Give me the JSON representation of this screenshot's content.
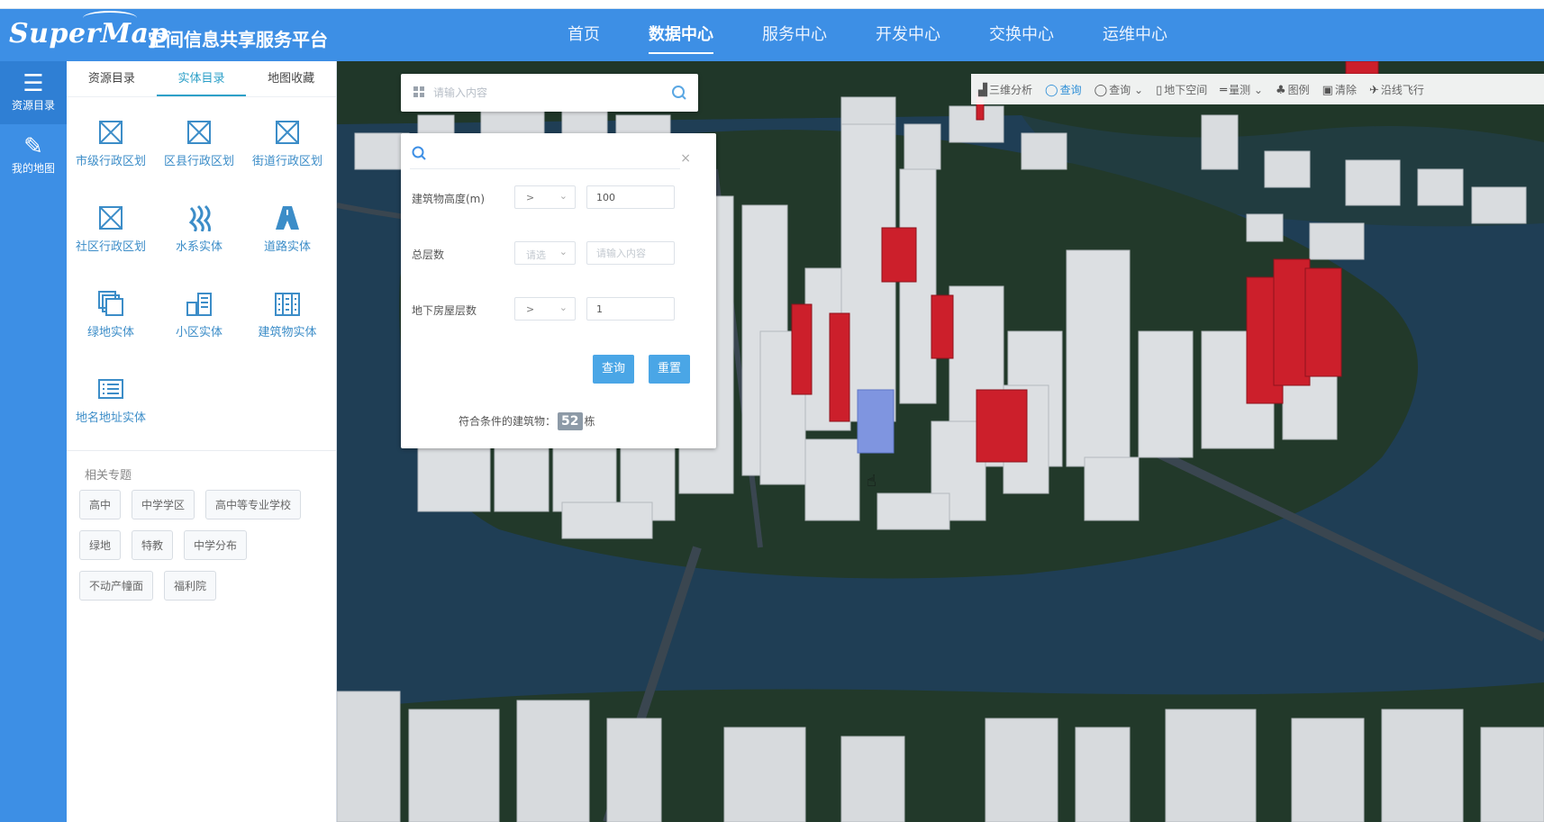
{
  "header": {
    "logo": "SuperMap",
    "platform_title": "空间信息共享服务平台",
    "nav": [
      {
        "label": "首页",
        "active": false
      },
      {
        "label": "数据中心",
        "active": true
      },
      {
        "label": "服务中心",
        "active": false
      },
      {
        "label": "开发中心",
        "active": false
      },
      {
        "label": "交换中心",
        "active": false
      },
      {
        "label": "运维中心",
        "active": false
      }
    ]
  },
  "rail": {
    "items": [
      {
        "label": "资源目录",
        "icon": "list-icon",
        "active": true
      },
      {
        "label": "我的地图",
        "icon": "edit-icon",
        "active": false
      }
    ]
  },
  "catalog": {
    "tabs": [
      {
        "label": "资源目录",
        "active": false
      },
      {
        "label": "实体目录",
        "active": true
      },
      {
        "label": "地图收藏",
        "active": false
      }
    ],
    "items": [
      {
        "label": "市级行政区划",
        "icon": "boundary-icon"
      },
      {
        "label": "区县行政区划",
        "icon": "boundary-icon"
      },
      {
        "label": "街道行政区划",
        "icon": "boundary-icon"
      },
      {
        "label": "社区行政区划",
        "icon": "boundary-icon"
      },
      {
        "label": "水系实体",
        "icon": "water-icon"
      },
      {
        "label": "道路实体",
        "icon": "road-icon"
      },
      {
        "label": "绿地实体",
        "icon": "layers-icon"
      },
      {
        "label": "小区实体",
        "icon": "residential-icon"
      },
      {
        "label": "建筑物实体",
        "icon": "building-icon"
      },
      {
        "label": "地名地址实体",
        "icon": "address-icon"
      }
    ],
    "related_title": "相关专题",
    "related": [
      "高中",
      "中学学区",
      "高中等专业学校",
      "绿地",
      "特教",
      "中学分布",
      "不动产幢面",
      "福利院"
    ]
  },
  "search": {
    "placeholder": "请输入内容"
  },
  "query": {
    "rows": [
      {
        "label": "建筑物高度(m)",
        "operator": ">",
        "value": "100",
        "placeholder": ""
      },
      {
        "label": "总层数",
        "operator": "请选",
        "value": "",
        "placeholder": "请输入内容"
      },
      {
        "label": "地下房屋层数",
        "operator": ">",
        "value": "1",
        "placeholder": ""
      }
    ],
    "close": "×",
    "query_button": "查询",
    "reset_button": "重置",
    "result_prefix": "符合条件的建筑物：",
    "result_count": "52",
    "result_suffix": "栋"
  },
  "toolbar": {
    "items": [
      {
        "label": "三维分析",
        "glyph": "▟",
        "icon": "terrain-icon",
        "active": false
      },
      {
        "label": "查询",
        "glyph": "◯",
        "icon": "search-icon",
        "active": true
      },
      {
        "label": "查询",
        "glyph": "◯",
        "icon": "search-icon",
        "active": false,
        "dropdown": true
      },
      {
        "label": "地下空间",
        "glyph": "▯",
        "icon": "underground-icon",
        "active": false
      },
      {
        "label": "量测",
        "glyph": "═",
        "icon": "measure-icon",
        "active": false,
        "dropdown": true
      },
      {
        "label": "图例",
        "glyph": "♣",
        "icon": "legend-icon",
        "active": false
      },
      {
        "label": "清除",
        "glyph": "▣",
        "icon": "trash-icon",
        "active": false
      },
      {
        "label": "沿线飞行",
        "glyph": "✈",
        "icon": "flight-icon",
        "active": false
      }
    ]
  },
  "colors": {
    "header": "#3d8fe5",
    "accent": "#2da0c8",
    "highlight_building": "#cc1f2b",
    "selected_building": "#7f95e0",
    "water": "#1f3e55"
  }
}
